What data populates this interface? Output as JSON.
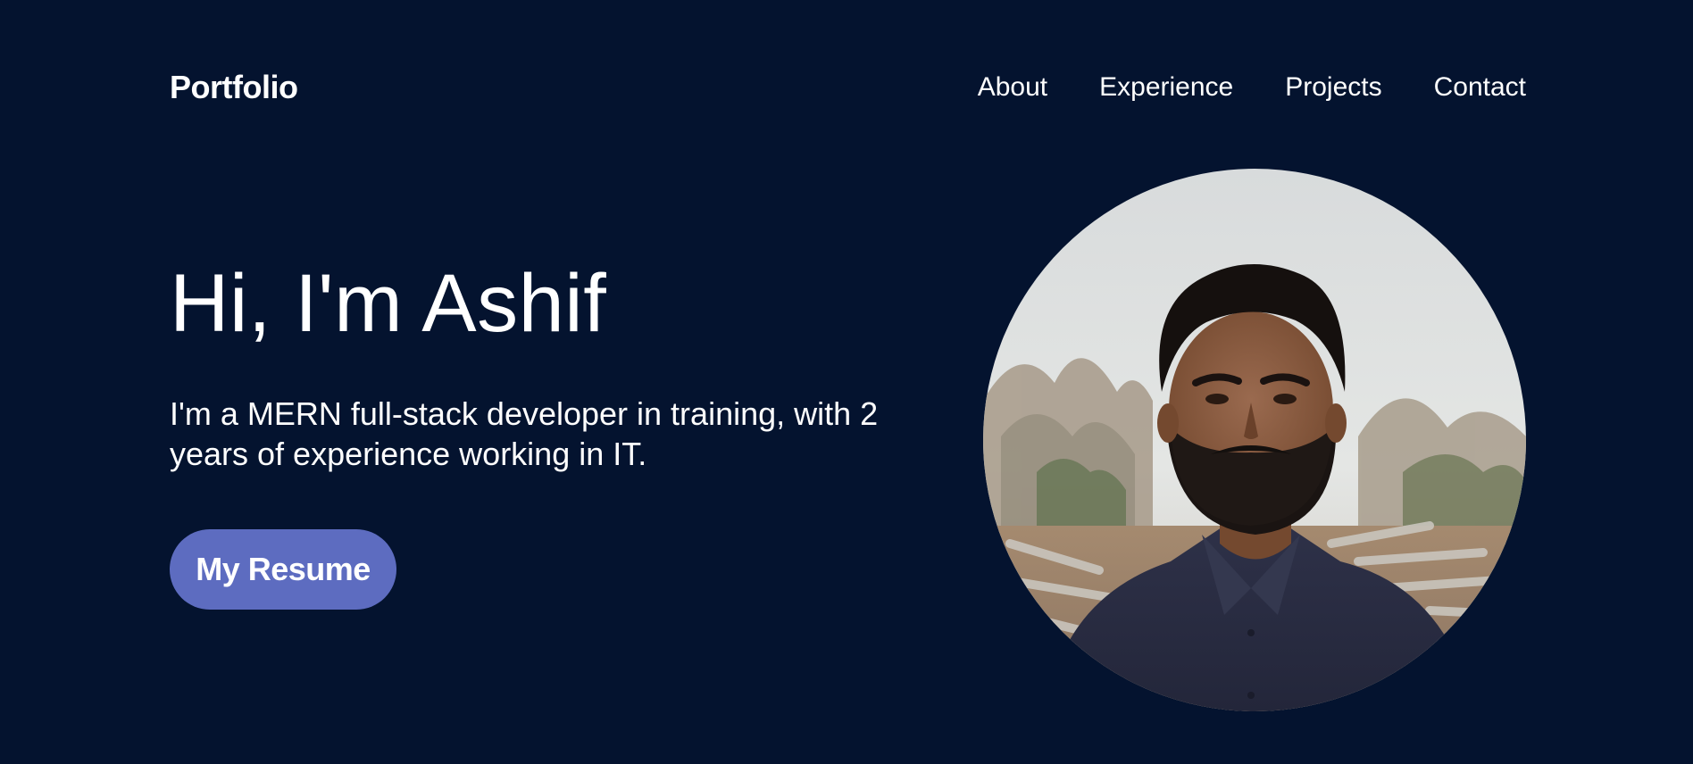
{
  "header": {
    "brand": "Portfolio",
    "nav": [
      {
        "label": "About"
      },
      {
        "label": "Experience"
      },
      {
        "label": "Projects"
      },
      {
        "label": "Contact"
      }
    ]
  },
  "hero": {
    "title": "Hi, I'm Ashif",
    "subtitle": "I'm a MERN full-stack developer in training, with 2 years of experience working in IT.",
    "resume_label": "My Resume"
  },
  "colors": {
    "background": "#04132f",
    "button": "#5d6cc0",
    "text": "#ffffff"
  }
}
